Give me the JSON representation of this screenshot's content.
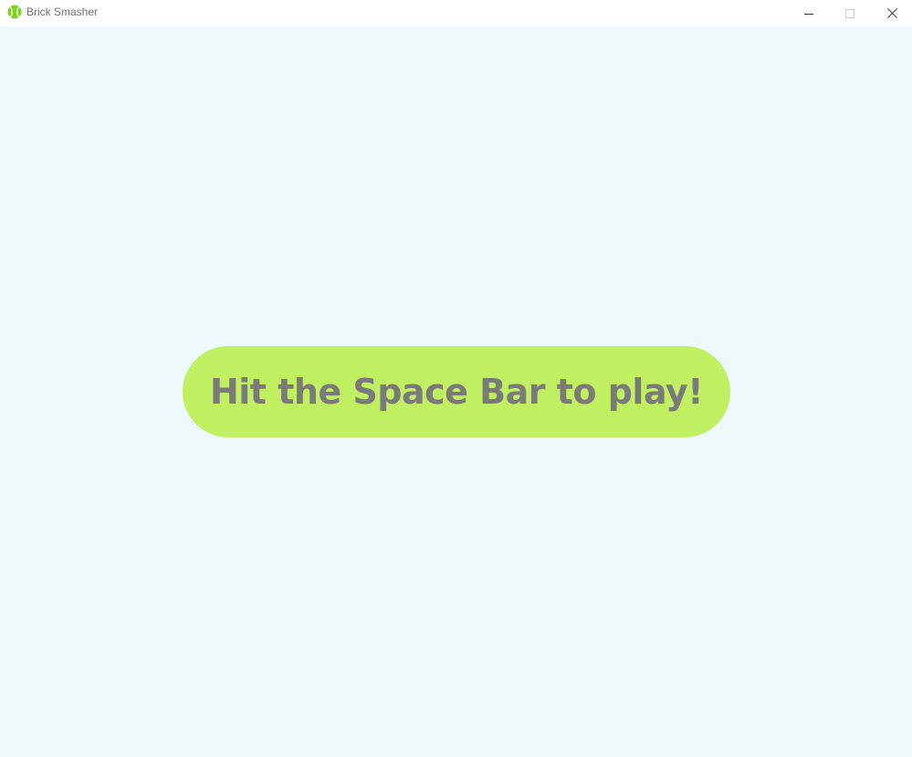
{
  "window": {
    "title": "Brick Smasher",
    "icon": "tennis-ball-icon",
    "controls": {
      "minimize": "minimize-icon",
      "maximize": "maximize-icon",
      "close": "close-icon"
    }
  },
  "game": {
    "prompt": "Hit the Space Bar to play!"
  },
  "colors": {
    "background": "#ecf8fa",
    "pill": "#c0ef61",
    "pill_text": "#7a7a7a",
    "icon_green": "#7ed321"
  }
}
